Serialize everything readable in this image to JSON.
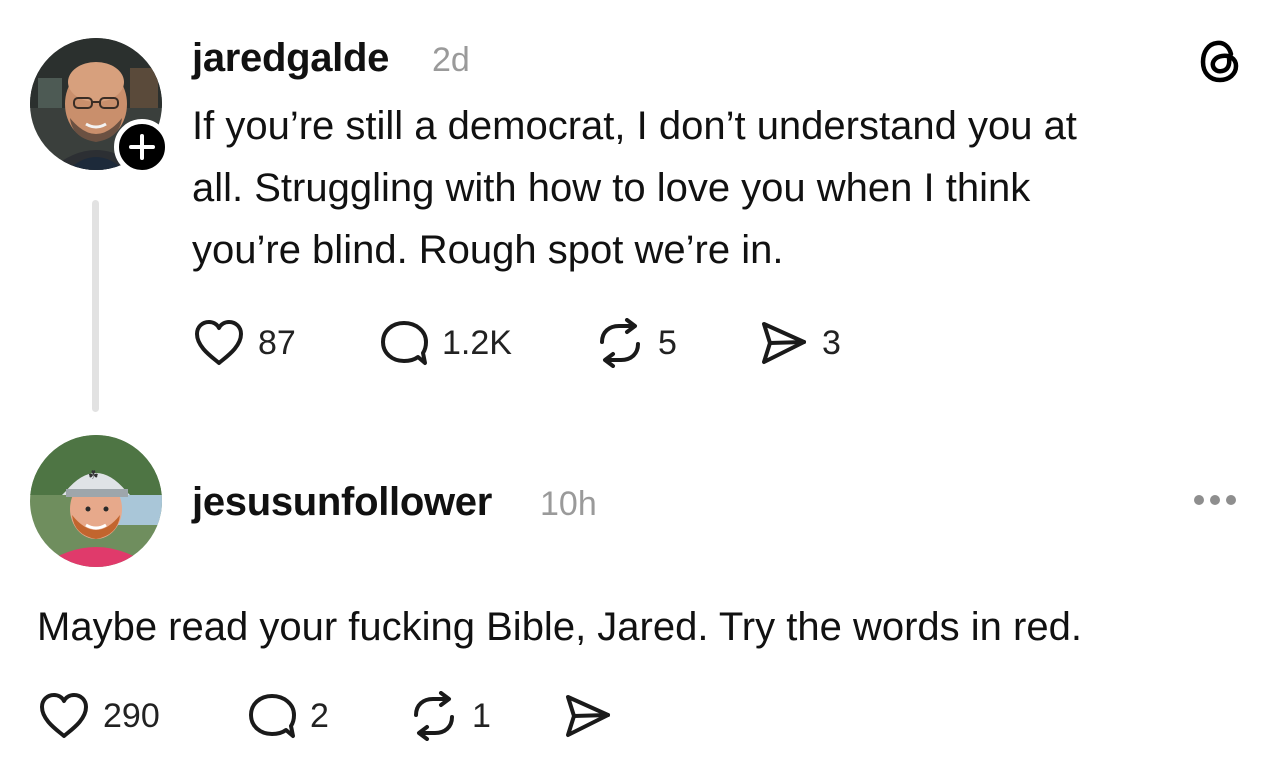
{
  "post": {
    "username": "jaredgalde",
    "time": "2d",
    "lines": [
      "If you’re still a democrat, I don’t understand you at",
      "all. Struggling with how to love you when I think",
      "you’re blind. Rough spot we’re in."
    ],
    "likes": "87",
    "replies": "1.2K",
    "reposts": "5",
    "shares": "3"
  },
  "reply": {
    "username": "jesusunfollower",
    "time": "10h",
    "text": "Maybe read your fucking Bible, Jared. Try the words in red.",
    "likes": "290",
    "replies": "2",
    "reposts": "1"
  },
  "icons": {
    "app_logo": "threads-logo-icon",
    "follow": "plus-icon",
    "like": "heart-icon",
    "reply": "comment-icon",
    "repost": "repost-icon",
    "share": "send-icon",
    "more": "ellipsis-icon"
  },
  "colors": {
    "text": "#111111",
    "muted": "#9a9a9a",
    "thread_line": "#e2e2e2",
    "badge": "#000000"
  }
}
